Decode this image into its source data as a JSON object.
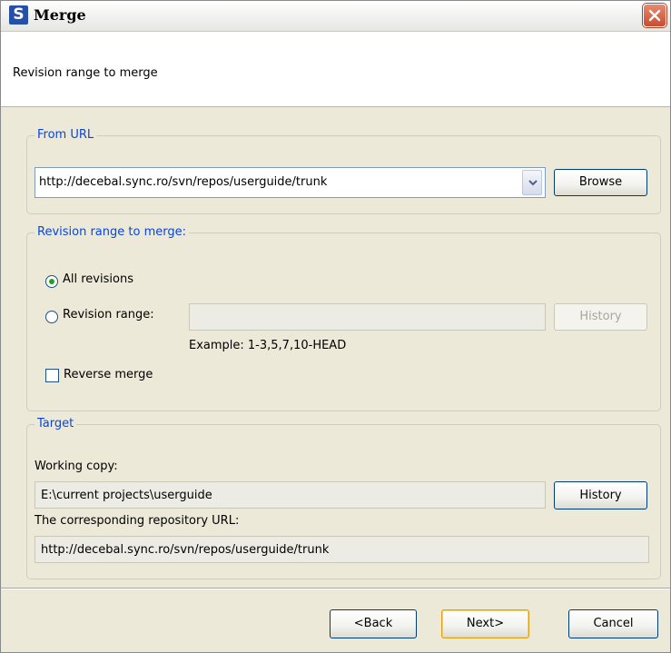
{
  "window": {
    "title": "Merge",
    "app_icon_letter": "S",
    "icons": {
      "close": "close-icon",
      "app": "app-icon",
      "combo_arrow": "chevron-down-icon"
    }
  },
  "header": {
    "text": "Revision range to merge"
  },
  "from_url": {
    "legend": "From URL",
    "url_value": "http://decebal.sync.ro/svn/repos/userguide/trunk",
    "browse_label": "Browse"
  },
  "revision": {
    "legend": "Revision range to merge:",
    "all_revisions_label": "All revisions",
    "all_revisions_selected": true,
    "revision_range_label": "Revision range:",
    "revision_range_selected": false,
    "revision_range_value": "",
    "history_label": "History",
    "example_text": "Example: 1-3,5,7,10-HEAD",
    "reverse_merge_label": "Reverse merge",
    "reverse_merge_checked": false
  },
  "target": {
    "legend": "Target",
    "working_copy_label": "Working copy:",
    "working_copy_value": "E:\\current projects\\userguide",
    "history_label": "History",
    "repo_url_label": "The corresponding repository URL:",
    "repo_url_value": "http://decebal.sync.ro/svn/repos/userguide/trunk"
  },
  "footer": {
    "back_label": "<Back",
    "next_label": "Next>",
    "cancel_label": "Cancel"
  }
}
